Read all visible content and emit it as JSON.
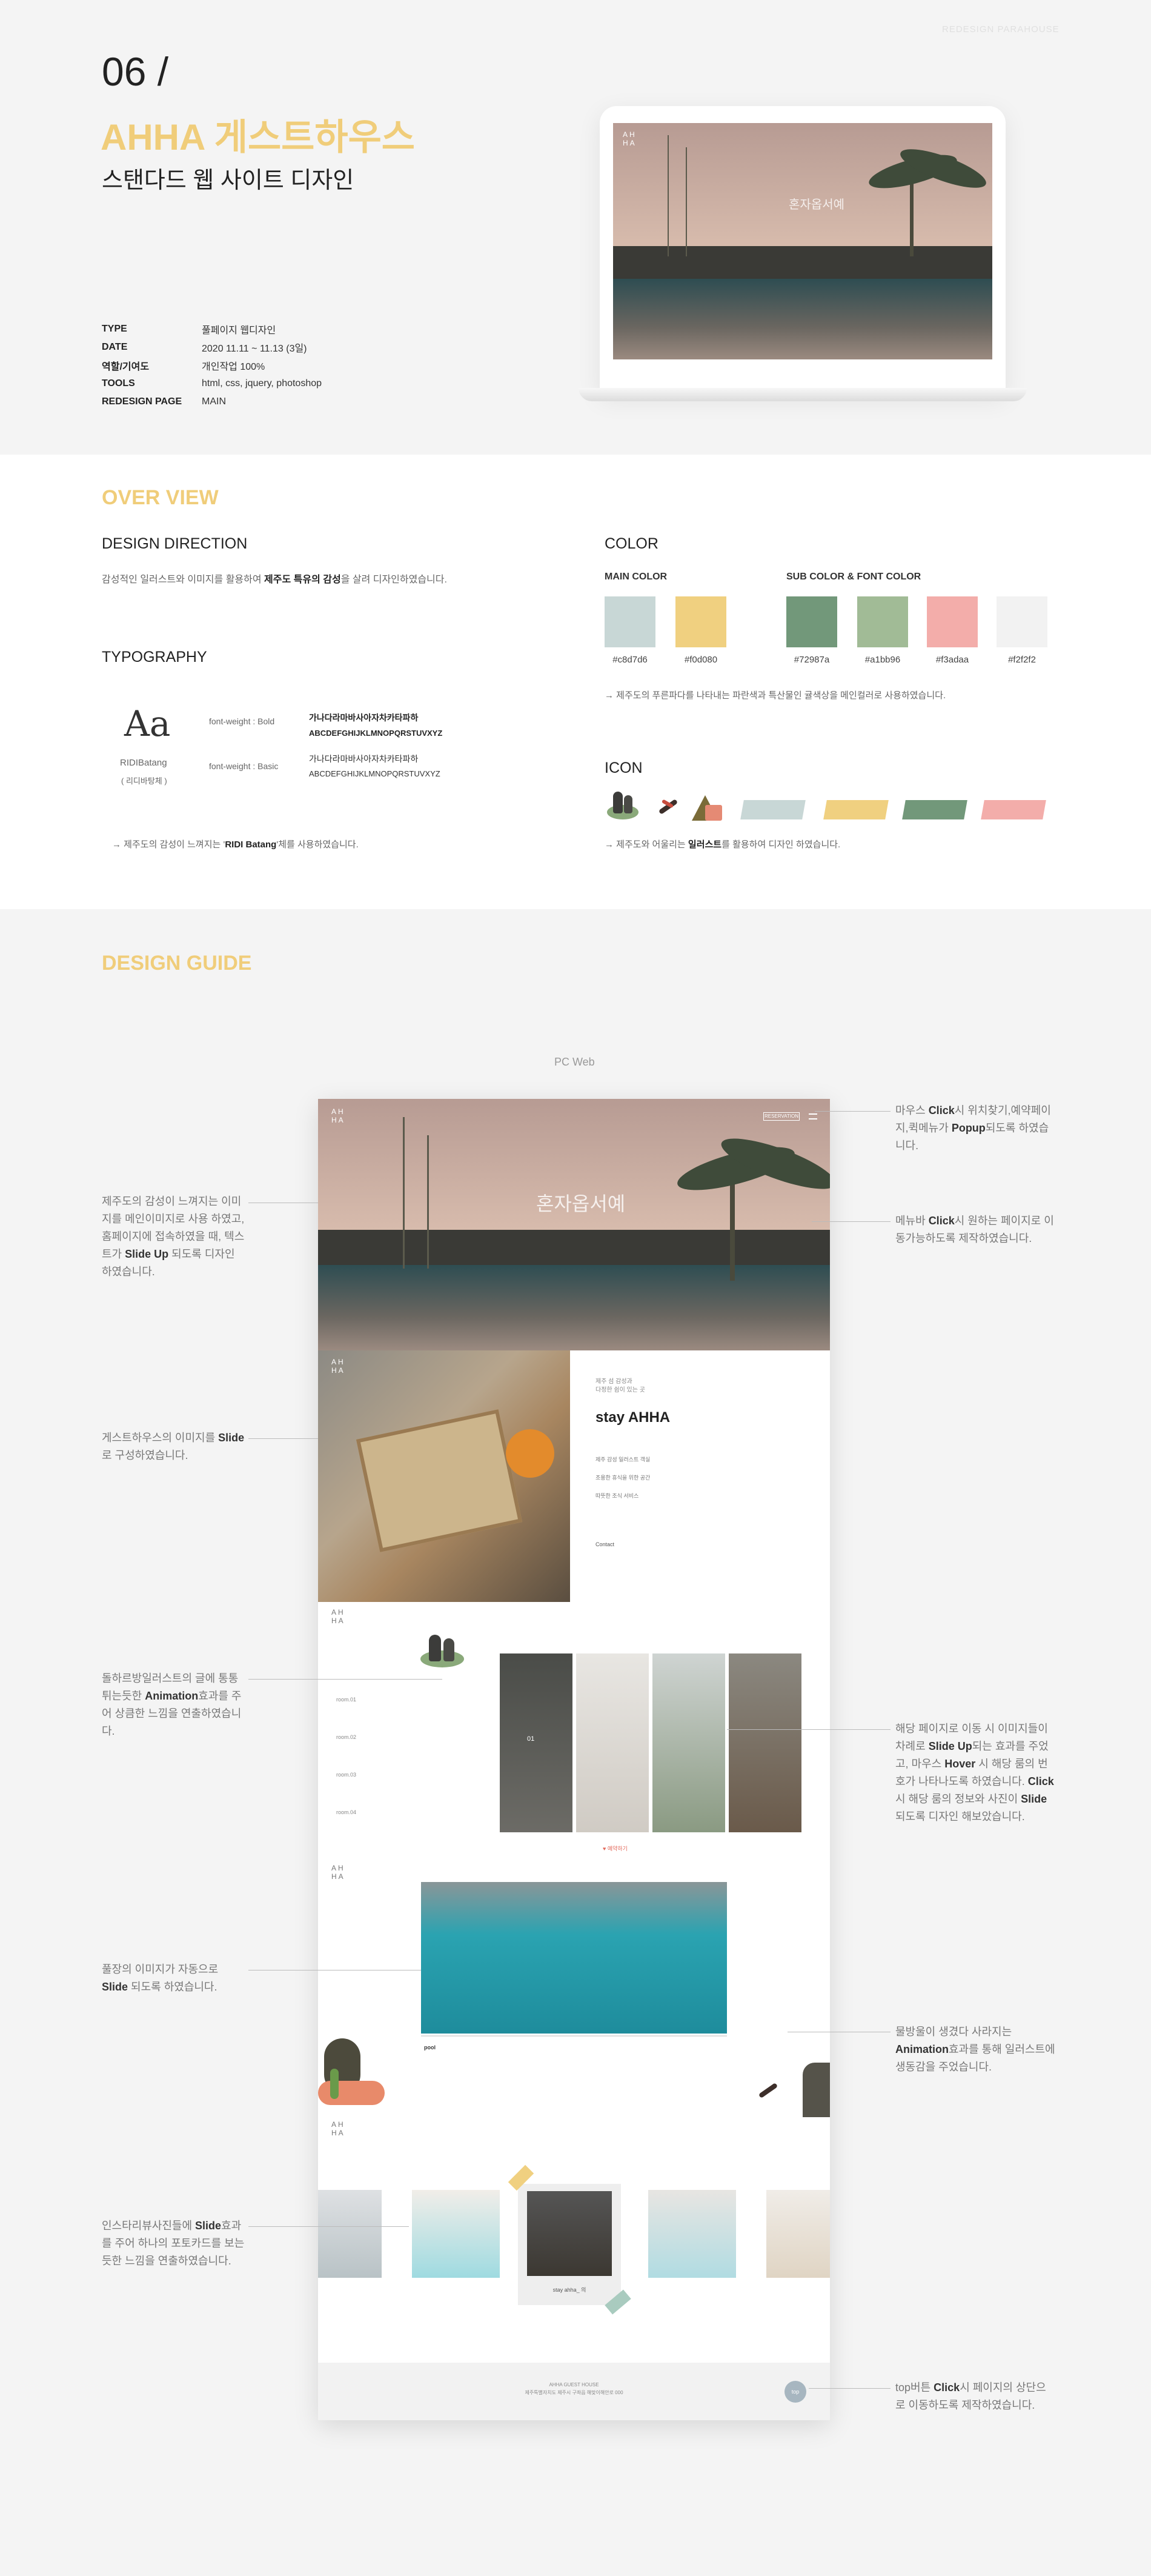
{
  "hero": {
    "watermark": "REDESIGN PARAHOUSE",
    "number": "06 /",
    "title": "AHHA 게스트하우스",
    "subtitle": "스탠다드 웹 사이트 디자인",
    "info": [
      {
        "key": "TYPE",
        "value": "풀페이지 웹디자인"
      },
      {
        "key": "DATE",
        "value": "2020 11.11 ~ 11.13 (3일)"
      },
      {
        "key": "역할/기여도",
        "value": "개인작업 100%"
      },
      {
        "key": "TOOLS",
        "value": "html, css, jquery, photoshop"
      },
      {
        "key": "REDESIGN PAGE",
        "value": "MAIN"
      }
    ],
    "screen_text": "혼자옵서예",
    "screen_logo": "AH\nHA"
  },
  "overview": {
    "title": "OVER VIEW",
    "direction": {
      "heading": "DESIGN DIRECTION",
      "text_before": "감성적인 일러스트와 이미지를 활용하여 ",
      "text_bold": "제주도 특유의 감성",
      "text_after": "을 살려 디자인하였습니다."
    },
    "typography": {
      "heading": "TYPOGRAPHY",
      "sample": "Aa",
      "font_name": "RIDIBatang",
      "font_name_kr": "( 리디바탕체 )",
      "bold_label": "font-weight : Bold",
      "basic_label": "font-weight : Basic",
      "korean_sample": "가나다라마바사아자차카타파하",
      "latin_sample": "ABCDEFGHIJKLMNOPQRSTUVXYZ",
      "note_before": "→  제주도의 감성이 느껴지는 '",
      "note_bold": "RIDI Batang",
      "note_after": "'체를 사용하였습니다."
    },
    "color": {
      "heading": "COLOR",
      "main_label": "MAIN COLOR",
      "sub_label": "SUB COLOR & FONT COLOR",
      "main": [
        {
          "hex": "#c8d7d6",
          "label": "#c8d7d6"
        },
        {
          "hex": "#f0d080",
          "label": "#f0d080"
        }
      ],
      "sub": [
        {
          "hex": "#72987a",
          "label": "#72987a"
        },
        {
          "hex": "#a1bb96",
          "label": "#a1bb96"
        },
        {
          "hex": "#f3adaa",
          "label": "#f3adaa"
        },
        {
          "hex": "#f2f2f2",
          "label": "#f2f2f2"
        }
      ],
      "note": "→  제주도의 푸른파다를 나타내는 파란색과 특산물인 귤색상을 메인컬러로 사용하였습니다."
    },
    "icon": {
      "heading": "ICON",
      "note_before": "→  제주도와 어울리는 ",
      "note_bold": "일러스트",
      "note_after": "를 활용하여 디자인 하였습니다.",
      "tapes": [
        "#c8d7d6",
        "#f0d080",
        "#72987a",
        "#f3adaa"
      ]
    }
  },
  "guide": {
    "title": "DESIGN GUIDE",
    "pc_web": "PC Web",
    "mock": {
      "logo": "AH\nHA",
      "reservation": "RESERVATION",
      "hero_text": "혼자옵서예",
      "stay_title": "stay AHHA",
      "stay_kicker": "제주 섬 감성과\n다정한 쉼이 있는 곳",
      "features": [
        "제주 감성 일러스트 객실",
        "조용한 휴식을 위한 공간",
        "따뜻한 조식 서비스"
      ],
      "contact": "Contact",
      "rooms": [
        "room.01",
        "room.02",
        "room.03",
        "room.04"
      ],
      "room_num": "01",
      "reserve_link": "♥ 예약하기",
      "pool_label": "pool",
      "insta_caption": "stay ahha_ 의",
      "footer_top": "top",
      "footer_text": "AHHA GUEST HOUSE\n제주특별자치도 제주시 구좌읍 해맞이해안로 000"
    },
    "annotations": {
      "left1": "제주도의 감성이 느껴지는 이미지를 메인이미지로 사용 하였고, 홈페이지에 접속하였을 때, 텍스트가 <b>Slide Up</b> 되도록 디자인 하였습니다.",
      "left2": "게스트하우스의 이미지를 <b>Slide</b>로 구성하였습니다.",
      "left3": "돌하르방일러스트의 글에 통통 튀는듯한 <b>Animation</b>효과를 주어 상큼한 느낌을 연출하였습니다.",
      "left4": "풀장의 이미지가 자동으로 <b>Slide</b> 되도록 하였습니다.",
      "left5": "인스타리뷰사진들에 <b>Slide</b>효과를 주어 하나의 포토카드를 보는듯한 느낌을 연출하였습니다.",
      "right1": "마우스 <b>Click</b>시 위치찾기,예약페이지,퀵메뉴가 <b>Popup</b>되도록 하였습니다.",
      "right2": "메뉴바 <b>Click</b>시 원하는 페이지로 이동가능하도록 제작하였습니다.",
      "right3": "해당 페이지로 이동 시 이미지들이 차례로 <b>Slide Up</b>되는 효과를 주었고, 마우스 <b>Hover</b> 시 해당 룸의 번호가 나타나도록 하였습니다. <b>Click</b>시 해당 룸의 정보와 사진이 <b>Slide</b> 되도록 디자인 해보았습니다.",
      "right4": "물방울이 생겼다 사라지는 <b>Animation</b>효과를 통해 일러스트에 생동감을 주었습니다.",
      "right5": "top버튼 <b>Click</b>시 페이지의 상단으로 이동하도록 제작하였습니다."
    }
  }
}
